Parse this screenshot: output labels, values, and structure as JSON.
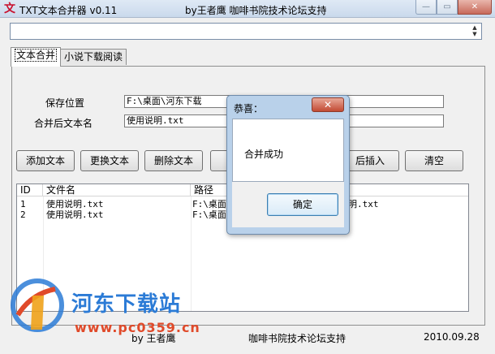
{
  "window": {
    "title": "TXT文本合并器 v0.11",
    "subtitle": "by王者鹰 咖啡书院技术论坛支持",
    "icon": "app-icon",
    "controls": [
      "—",
      "▭",
      "✕"
    ]
  },
  "top_input": {
    "value": ""
  },
  "tabs": [
    {
      "label": "文本合并",
      "active": true
    },
    {
      "label": "小说下载阅读",
      "active": false
    }
  ],
  "form": {
    "save_location_label": "保存位置",
    "save_location_value": "F:\\桌面\\河东下载",
    "merged_name_label": "合并后文本名",
    "merged_name_value": "使用说明.txt"
  },
  "buttons": {
    "add": "添加文本",
    "replace": "更换文本",
    "delete": "删除文本",
    "insert_after": "后插入",
    "clear": "清空"
  },
  "list": {
    "columns": [
      "ID",
      "文件名",
      "路径"
    ],
    "rows": [
      {
        "id": "1",
        "name": "使用说明.txt",
        "path": "F:\\桌面",
        "tail": "明.txt"
      },
      {
        "id": "2",
        "name": "使用说明.txt",
        "path": "F:\\桌面",
        "tail": ""
      }
    ]
  },
  "footer": {
    "author": "by 王者鹰",
    "support": "咖啡书院技术论坛支持",
    "date": "2010.09.28"
  },
  "watermark": {
    "site_name": "河东下载站",
    "url": "www.pc0359.cn"
  },
  "dialog": {
    "title": "恭喜：",
    "close": "✕",
    "message": "合并成功",
    "ok": "确定"
  },
  "colors": {
    "accent": "#2b7bd6",
    "watermark_red": "#e04a2a",
    "dialog_frame": "#b9d1ea"
  }
}
